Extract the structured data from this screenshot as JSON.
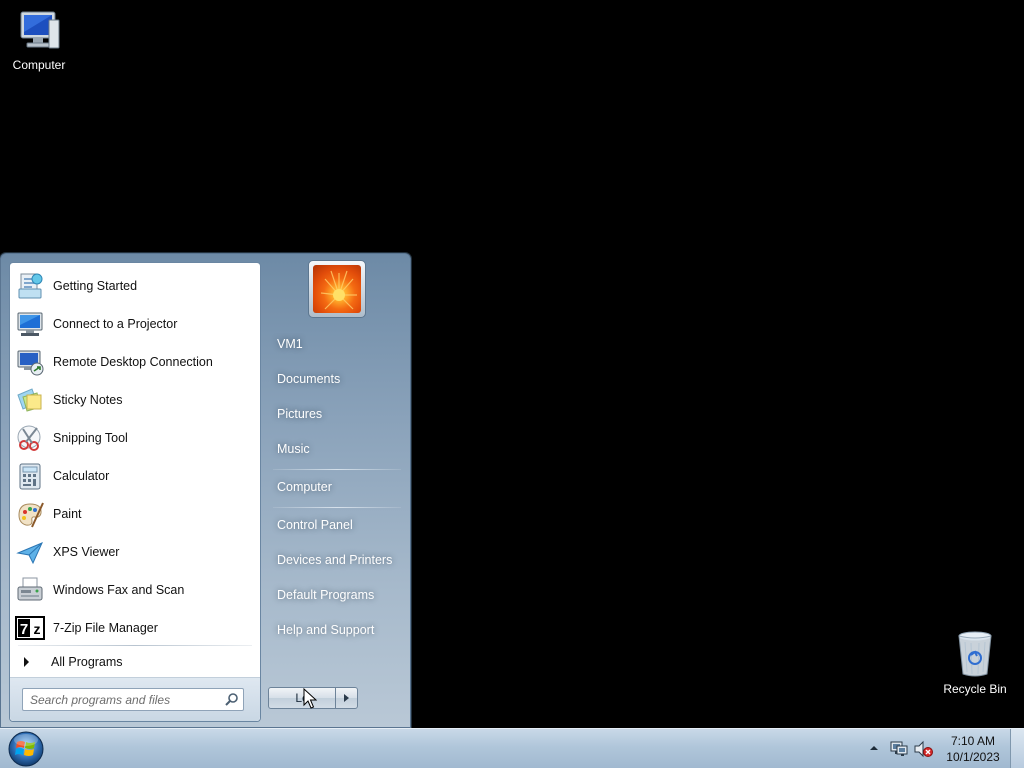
{
  "desktop": {
    "icons": [
      {
        "label": "Computer"
      },
      {
        "label": "Recycle Bin"
      }
    ]
  },
  "start_menu": {
    "programs": [
      {
        "label": "Getting Started",
        "icon": "getting-started-icon"
      },
      {
        "label": "Connect to a Projector",
        "icon": "projector-icon"
      },
      {
        "label": "Remote Desktop Connection",
        "icon": "remote-desktop-icon"
      },
      {
        "label": "Sticky Notes",
        "icon": "sticky-notes-icon"
      },
      {
        "label": "Snipping Tool",
        "icon": "scissors-icon"
      },
      {
        "label": "Calculator",
        "icon": "calculator-icon"
      },
      {
        "label": "Paint",
        "icon": "paint-palette-icon"
      },
      {
        "label": "XPS Viewer",
        "icon": "xps-viewer-icon"
      },
      {
        "label": "Windows Fax and Scan",
        "icon": "fax-icon"
      },
      {
        "label": "7-Zip File Manager",
        "icon": "7zip-icon"
      }
    ],
    "all_programs": "All Programs",
    "search": {
      "placeholder": "Search programs and files",
      "value": ""
    },
    "right_items": [
      {
        "label": "VM1"
      },
      {
        "label": "Documents"
      },
      {
        "label": "Pictures"
      },
      {
        "label": "Music"
      },
      {
        "label": "Computer"
      },
      {
        "label": "Control Panel"
      },
      {
        "label": "Devices and Printers"
      },
      {
        "label": "Default Programs"
      },
      {
        "label": "Help and Support"
      }
    ],
    "logoff_label": "Lo",
    "user_picture": "flower-picture"
  },
  "taskbar": {
    "clock": {
      "time": "7:10 AM",
      "date": "10/1/2023"
    },
    "tray_icons": [
      "show-hidden-icons-chevron",
      "network-icon",
      "volume-muted-icon"
    ]
  },
  "colors": {
    "desktop_bg": "#000000",
    "taskbar": "#b0c6da",
    "start_menu_frame": "#8aa2ba"
  }
}
